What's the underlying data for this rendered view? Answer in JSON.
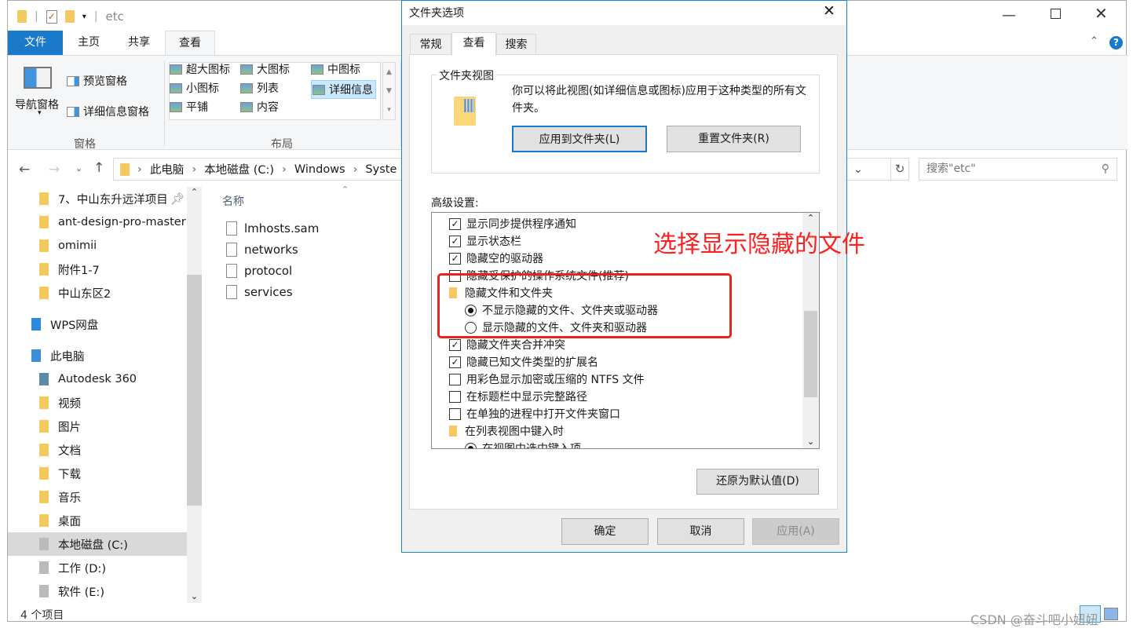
{
  "explorer": {
    "title": "etc",
    "ribbon_tabs": [
      "文件",
      "主页",
      "共享",
      "查看"
    ],
    "active_tab": "查看",
    "pane_group": {
      "nav_pane": "导航窗格",
      "preview_pane": "预览窗格",
      "details_pane": "详细信息窗格",
      "label": "窗格"
    },
    "layout_group": {
      "items": [
        "超大图标",
        "大图标",
        "中图标",
        "小图标",
        "列表",
        "详细信息",
        "平铺",
        "内容"
      ],
      "selected": "详细信息",
      "label": "布局"
    },
    "breadcrumb": [
      "此电脑",
      "本地磁盘 (C:)",
      "Windows",
      "Syste"
    ],
    "search_placeholder": "搜索\"etc\"",
    "nav_items": [
      {
        "label": "7、中山东升远洋项目",
        "icon": "folder-icon"
      },
      {
        "label": "ant-design-pro-master",
        "icon": "folder-icon"
      },
      {
        "label": "omimii",
        "icon": "folder-icon"
      },
      {
        "label": "附件1-7",
        "icon": "folder-icon"
      },
      {
        "label": "中山东区2",
        "icon": "folder-icon"
      },
      {
        "label": "WPS网盘",
        "icon": "cloud-icon"
      },
      {
        "label": "此电脑",
        "icon": "computer-icon"
      },
      {
        "label": "Autodesk 360",
        "icon": "autodesk-icon"
      },
      {
        "label": "视频",
        "icon": "videos-folder-icon"
      },
      {
        "label": "图片",
        "icon": "pictures-folder-icon"
      },
      {
        "label": "文档",
        "icon": "documents-folder-icon"
      },
      {
        "label": "下载",
        "icon": "downloads-folder-icon"
      },
      {
        "label": "音乐",
        "icon": "music-folder-icon"
      },
      {
        "label": "桌面",
        "icon": "desktop-folder-icon"
      },
      {
        "label": "本地磁盘 (C:)",
        "icon": "drive-icon",
        "selected": true
      },
      {
        "label": "工作 (D:)",
        "icon": "drive-icon"
      },
      {
        "label": "软件 (E:)",
        "icon": "drive-icon"
      }
    ],
    "column_header": "名称",
    "files": [
      "lmhosts.sam",
      "networks",
      "protocol",
      "services"
    ],
    "status": "4 个项目"
  },
  "dialog": {
    "title": "文件夹选项",
    "tabs": [
      "常规",
      "查看",
      "搜索"
    ],
    "active_tab": "查看",
    "folder_views": {
      "label": "文件夹视图",
      "description": "你可以将此视图(如详细信息或图标)应用于这种类型的所有文件夹。",
      "apply_button": "应用到文件夹(L)",
      "reset_button": "重置文件夹(R)"
    },
    "advanced_label": "高级设置:",
    "advanced_items": [
      {
        "type": "checkbox",
        "label": "显示同步提供程序通知",
        "checked": true
      },
      {
        "type": "checkbox",
        "label": "显示状态栏",
        "checked": true
      },
      {
        "type": "checkbox",
        "label": "隐藏空的驱动器",
        "checked": true
      },
      {
        "type": "checkbox",
        "label": "隐藏受保护的操作系统文件(推荐)",
        "checked": false
      },
      {
        "type": "folder",
        "label": "隐藏文件和文件夹"
      },
      {
        "type": "radio",
        "label": "不显示隐藏的文件、文件夹或驱动器",
        "checked": true
      },
      {
        "type": "radio",
        "label": "显示隐藏的文件、文件夹和驱动器",
        "checked": false
      },
      {
        "type": "checkbox",
        "label": "隐藏文件夹合并冲突",
        "checked": true
      },
      {
        "type": "checkbox",
        "label": "隐藏已知文件类型的扩展名",
        "checked": true
      },
      {
        "type": "checkbox",
        "label": "用彩色显示加密或压缩的 NTFS 文件",
        "checked": false
      },
      {
        "type": "checkbox",
        "label": "在标题栏中显示完整路径",
        "checked": false
      },
      {
        "type": "checkbox",
        "label": "在单独的进程中打开文件夹窗口",
        "checked": false
      },
      {
        "type": "folder",
        "label": "在列表视图中键入时"
      },
      {
        "type": "radio",
        "label": "在视图中选中键入项",
        "checked": true
      }
    ],
    "restore_defaults": "还原为默认值(D)",
    "ok": "确定",
    "cancel": "取消",
    "apply": "应用(A)"
  },
  "annotation": {
    "text": "选择显示隐藏的文件",
    "color": "#ff2020"
  },
  "watermark": "CSDN @奋斗吧小妞妞",
  "colors": {
    "accent": "#1979ca",
    "dialog_border": "#1883d7",
    "annotation_box": "#e8231f"
  }
}
